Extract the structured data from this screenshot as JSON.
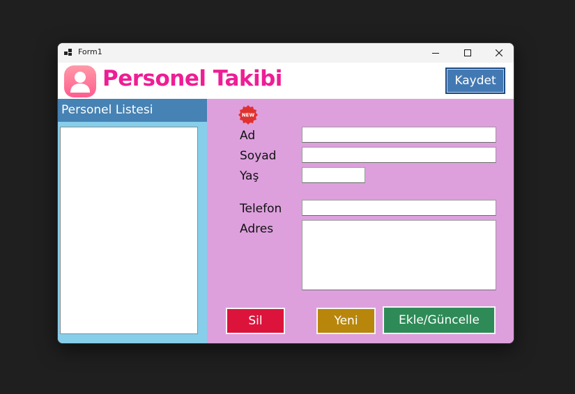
{
  "window": {
    "title": "Form1",
    "controls": [
      "minimize",
      "maximize",
      "close"
    ]
  },
  "header": {
    "logo_icon": "user-profile-icon",
    "title": "Personel Takibi",
    "save_label": "Kaydet"
  },
  "sidebar": {
    "title": "Personel Listesi",
    "items": []
  },
  "form": {
    "badge": "NEW",
    "fields": {
      "ad": {
        "label": "Ad",
        "value": ""
      },
      "soyad": {
        "label": "Soyad",
        "value": ""
      },
      "yas": {
        "label": "Yaş",
        "value": ""
      },
      "telefon": {
        "label": "Telefon",
        "value": ""
      },
      "adres": {
        "label": "Adres",
        "value": ""
      }
    },
    "buttons": {
      "delete": "Sil",
      "new": "Yeni",
      "add_update": "Ekle/Güncelle"
    }
  },
  "colors": {
    "title_pink": "#ee1e94",
    "sidebar_header": "#4682b4",
    "sidebar_bg": "#87ceeb",
    "form_bg": "#dda0dd",
    "delete": "#dc143c",
    "new": "#b8860b",
    "add_update": "#2e8b57",
    "save": "#4379b3"
  }
}
